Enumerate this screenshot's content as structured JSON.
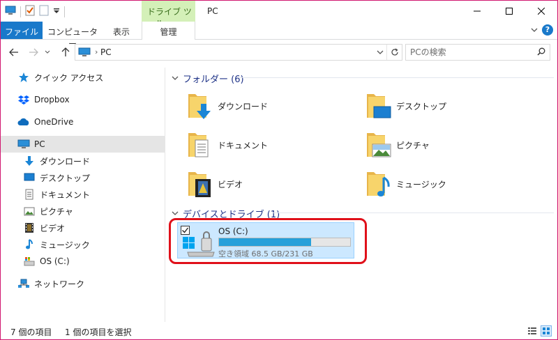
{
  "window": {
    "title": "PC",
    "context_tab": "ドライブ ツール"
  },
  "ribbon": {
    "tabs": [
      {
        "label": "ファイル"
      },
      {
        "label": "コンピューター"
      },
      {
        "label": "表示"
      },
      {
        "label": "管理"
      }
    ],
    "help": "?"
  },
  "address": {
    "path": "PC",
    "search_placeholder": "PCの検索"
  },
  "navpane": {
    "items": [
      {
        "label": "クイック アクセス",
        "icon": "star-icon"
      },
      {
        "label": "Dropbox",
        "icon": "dropbox-icon"
      },
      {
        "label": "OneDrive",
        "icon": "cloud-icon"
      },
      {
        "label": "PC",
        "icon": "computer-icon"
      },
      {
        "label": "ダウンロード",
        "icon": "download-icon"
      },
      {
        "label": "デスクトップ",
        "icon": "desktop-icon"
      },
      {
        "label": "ドキュメント",
        "icon": "document-icon"
      },
      {
        "label": "ピクチャ",
        "icon": "picture-icon"
      },
      {
        "label": "ビデオ",
        "icon": "video-icon"
      },
      {
        "label": "ミュージック",
        "icon": "music-icon"
      },
      {
        "label": "OS (C:)",
        "icon": "drive-icon"
      },
      {
        "label": "ネットワーク",
        "icon": "network-icon"
      }
    ]
  },
  "content": {
    "folders_header": "フォルダー (6)",
    "folders": [
      {
        "label": "ダウンロード",
        "icon": "download-folder-icon"
      },
      {
        "label": "デスクトップ",
        "icon": "desktop-folder-icon"
      },
      {
        "label": "ドキュメント",
        "icon": "document-folder-icon"
      },
      {
        "label": "ピクチャ",
        "icon": "picture-folder-icon"
      },
      {
        "label": "ビデオ",
        "icon": "video-folder-icon"
      },
      {
        "label": "ミュージック",
        "icon": "music-folder-icon"
      }
    ],
    "devices_header": "デバイスとドライブ (1)",
    "drive": {
      "name": "OS (C:)",
      "space": "空き領域 68.5 GB/231 GB",
      "used_fraction": 0.7035
    }
  },
  "status": {
    "count": "7 個の項目",
    "selected": "1 個の項目を選択"
  },
  "colors": {
    "accent": "#1979ca",
    "selection": "#cce8ff",
    "highlight_border": "#e0101a",
    "drive_bar": "#26a0da",
    "group_header": "#1e3287"
  }
}
